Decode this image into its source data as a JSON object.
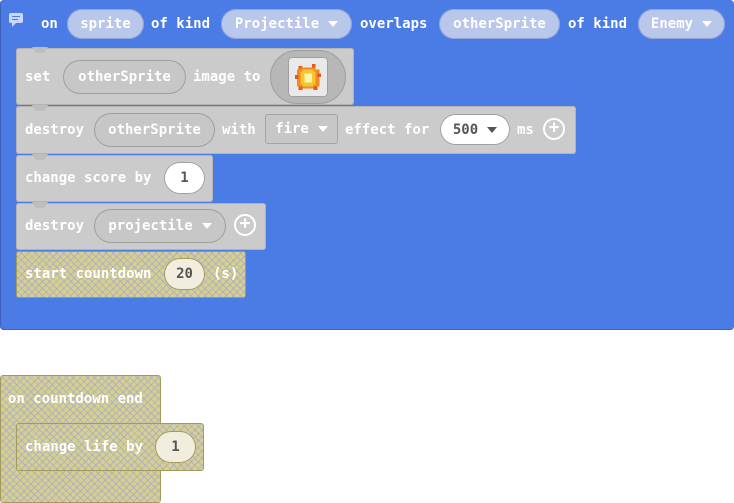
{
  "event_block": {
    "on": "on",
    "sprite_var": "sprite",
    "of_kind_1": "of kind",
    "kind_1": "Projectile",
    "overlaps": "overlaps",
    "other_var": "otherSprite",
    "of_kind_2": "of kind",
    "kind_2": "Enemy"
  },
  "set_image": {
    "set": "set",
    "target": "otherSprite",
    "image_to": "image to",
    "image_icon": "fire-sprite-image"
  },
  "destroy_effect": {
    "destroy": "destroy",
    "target": "otherSprite",
    "with": "with",
    "effect": "fire",
    "effect_for": "effect for",
    "duration": "500",
    "ms": "ms"
  },
  "change_score": {
    "label": "change score by",
    "value": "1"
  },
  "destroy_projectile": {
    "destroy": "destroy",
    "target": "projectile"
  },
  "start_countdown": {
    "label": "start countdown",
    "value": "20",
    "unit": "(s)"
  },
  "countdown_event": {
    "label": "on countdown end"
  },
  "change_life": {
    "label": "change life by",
    "value": "1"
  },
  "colors": {
    "event_blue": "#4b7be5",
    "grey_block": "#cbcbcb",
    "pattern_block": "#d6cf8f"
  }
}
